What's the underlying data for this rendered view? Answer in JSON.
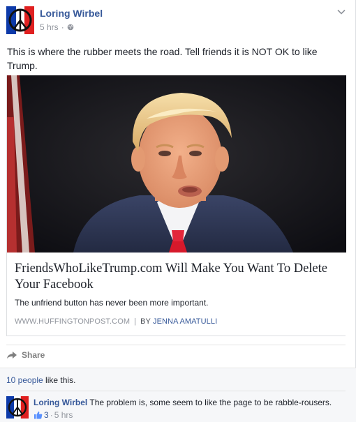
{
  "post": {
    "author": "Loring Wirbel",
    "time": "5 hrs",
    "meta_separator": "·",
    "privacy_icon": "globe-icon",
    "menu_icon": "chevron-down-icon",
    "text": "This is where the rubber meets the road. Tell friends it is NOT OK to like Trump."
  },
  "link": {
    "title": "FriendsWhoLikeTrump.com Will Make You Want To Delete Your Facebook",
    "description": "The unfriend button has never been more important.",
    "source": "WWW.HUFFINGTONPOST.COM",
    "separator": "|",
    "by_prefix": "BY",
    "author": "JENNA AMATULLI"
  },
  "actions": {
    "share_label": "Share",
    "share_icon": "share-arrow-icon"
  },
  "feedback": {
    "likes_count": "10 people",
    "likes_suffix": " like this."
  },
  "comment": {
    "author": "Loring Wirbel",
    "text": "The problem is, some seem to like the page to be rabble-rousers.",
    "like_icon": "thumbs-up-icon",
    "like_count": "3",
    "separator": "·",
    "time": "5 hrs"
  },
  "colors": {
    "link_blue": "#365899",
    "meta_gray": "#90949c",
    "text": "#1d2129",
    "feedback_bg": "#f6f7f9",
    "flag_blue": "#0d3aa9",
    "flag_red": "#e02020"
  }
}
